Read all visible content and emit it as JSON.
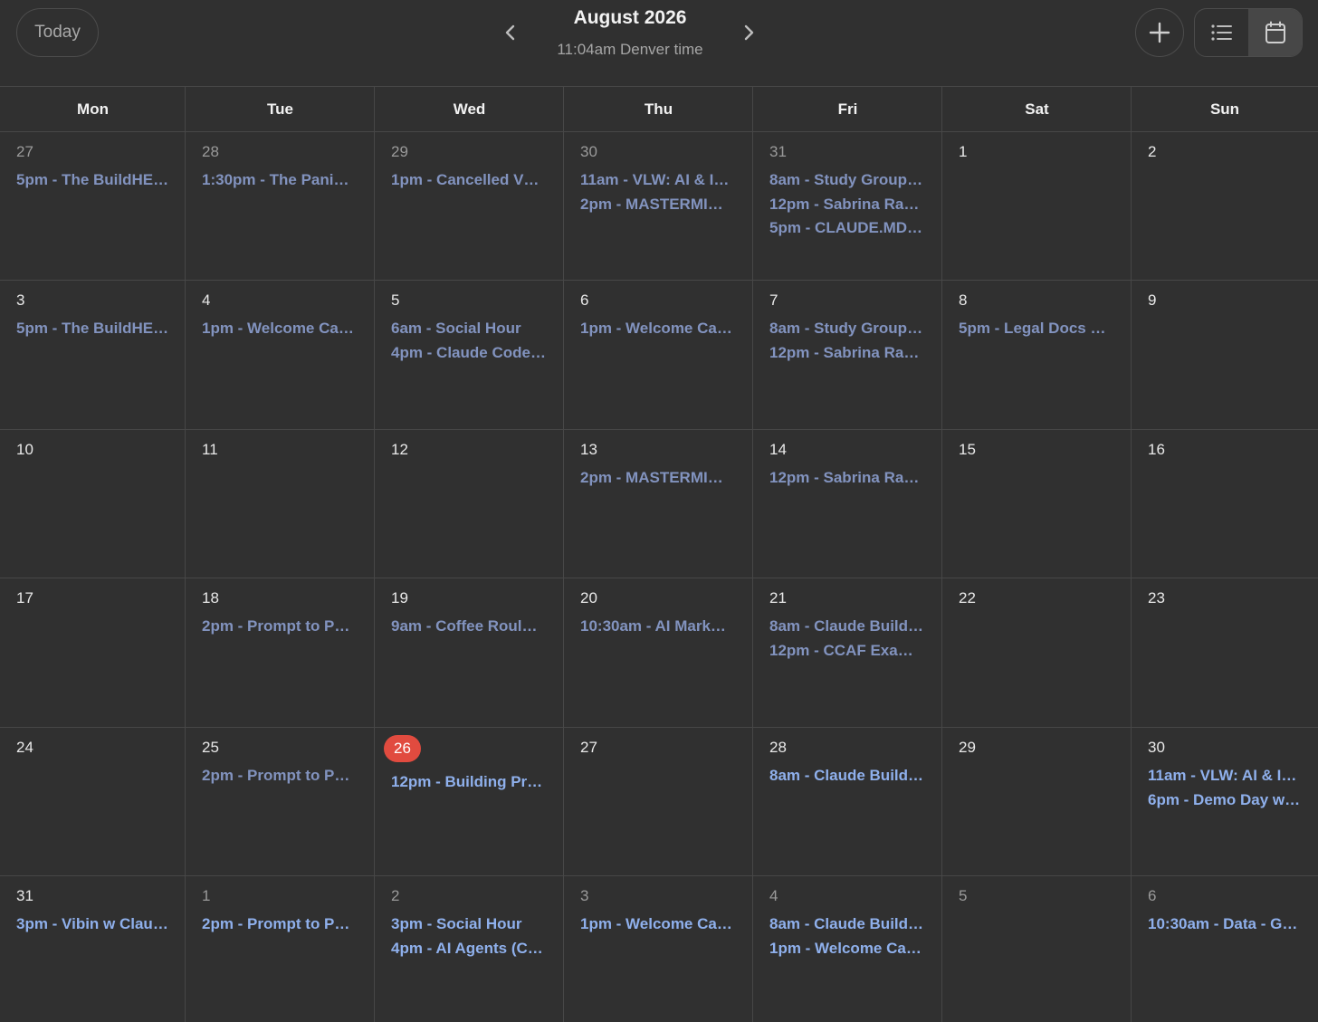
{
  "header": {
    "today_label": "Today",
    "month_title": "August 2026",
    "local_time": "11:04am Denver time",
    "prev_icon": "chevron-left-icon",
    "next_icon": "chevron-right-icon",
    "add_icon": "plus-icon",
    "list_view_icon": "list-icon",
    "calendar_view_icon": "calendar-icon",
    "active_view": "calendar"
  },
  "weekdays": [
    "Mon",
    "Tue",
    "Wed",
    "Thu",
    "Fri",
    "Sat",
    "Sun"
  ],
  "colors": {
    "background": "#303030",
    "grid_line": "#474747",
    "past_event": "#8293bf",
    "future_event": "#8fb0ec",
    "today_badge": "#e14b3f"
  },
  "weeks": [
    {
      "days": [
        {
          "date": "27",
          "muted": true,
          "events": [
            "5pm - The BuildHE…"
          ]
        },
        {
          "date": "28",
          "muted": true,
          "events": [
            "1:30pm - The Pani…"
          ]
        },
        {
          "date": "29",
          "muted": true,
          "events": [
            "1pm - Cancelled V…"
          ]
        },
        {
          "date": "30",
          "muted": true,
          "events": [
            "11am - VLW: AI & I…",
            "2pm - MASTERMI…"
          ]
        },
        {
          "date": "31",
          "muted": true,
          "events": [
            "8am - Study Group…",
            "12pm - Sabrina Ra…",
            "5pm - CLAUDE.MD…"
          ]
        },
        {
          "date": "1",
          "events": []
        },
        {
          "date": "2",
          "events": []
        }
      ]
    },
    {
      "days": [
        {
          "date": "3",
          "events": [
            "5pm - The BuildHE…"
          ]
        },
        {
          "date": "4",
          "events": [
            "1pm - Welcome Ca…"
          ]
        },
        {
          "date": "5",
          "events": [
            "6am - Social Hour",
            "4pm - Claude Code…"
          ]
        },
        {
          "date": "6",
          "events": [
            "1pm - Welcome Ca…"
          ]
        },
        {
          "date": "7",
          "events": [
            "8am - Study Group…",
            "12pm - Sabrina Ra…"
          ]
        },
        {
          "date": "8",
          "events": [
            "5pm - Legal Docs …"
          ]
        },
        {
          "date": "9",
          "events": []
        }
      ]
    },
    {
      "days": [
        {
          "date": "10",
          "events": []
        },
        {
          "date": "11",
          "events": []
        },
        {
          "date": "12",
          "events": []
        },
        {
          "date": "13",
          "events": [
            "2pm - MASTERMI…"
          ]
        },
        {
          "date": "14",
          "events": [
            "12pm - Sabrina Ra…"
          ]
        },
        {
          "date": "15",
          "events": []
        },
        {
          "date": "16",
          "events": []
        }
      ]
    },
    {
      "days": [
        {
          "date": "17",
          "events": []
        },
        {
          "date": "18",
          "events": [
            "2pm - Prompt to P…"
          ]
        },
        {
          "date": "19",
          "events": [
            "9am - Coffee Roul…"
          ]
        },
        {
          "date": "20",
          "events": [
            "10:30am - AI Mark…"
          ]
        },
        {
          "date": "21",
          "events": [
            "8am - Claude Build…",
            "12pm - CCAF Exa…"
          ]
        },
        {
          "date": "22",
          "events": []
        },
        {
          "date": "23",
          "events": []
        }
      ]
    },
    {
      "days": [
        {
          "date": "24",
          "events": []
        },
        {
          "date": "25",
          "events": [
            "2pm - Prompt to P…"
          ]
        },
        {
          "date": "26",
          "today": true,
          "future": true,
          "events": [
            "12pm - Building Pr…"
          ]
        },
        {
          "date": "27",
          "future": true,
          "events": []
        },
        {
          "date": "28",
          "future": true,
          "events": [
            "8am - Claude Build…"
          ]
        },
        {
          "date": "29",
          "future": true,
          "events": []
        },
        {
          "date": "30",
          "future": true,
          "events": [
            "11am - VLW: AI & I…",
            "6pm - Demo Day w…"
          ]
        }
      ]
    },
    {
      "days": [
        {
          "date": "31",
          "future": true,
          "events": [
            "3pm - Vibin w Clau…"
          ]
        },
        {
          "date": "1",
          "muted": true,
          "future": true,
          "events": [
            "2pm - Prompt to P…"
          ]
        },
        {
          "date": "2",
          "muted": true,
          "future": true,
          "events": [
            "3pm - Social Hour",
            "4pm - AI Agents (C…"
          ]
        },
        {
          "date": "3",
          "muted": true,
          "future": true,
          "events": [
            "1pm - Welcome Ca…"
          ]
        },
        {
          "date": "4",
          "muted": true,
          "future": true,
          "events": [
            "8am - Claude Build…",
            "1pm - Welcome Ca…"
          ]
        },
        {
          "date": "5",
          "muted": true,
          "future": true,
          "events": []
        },
        {
          "date": "6",
          "muted": true,
          "future": true,
          "events": [
            "10:30am - Data - G…"
          ]
        }
      ]
    }
  ]
}
